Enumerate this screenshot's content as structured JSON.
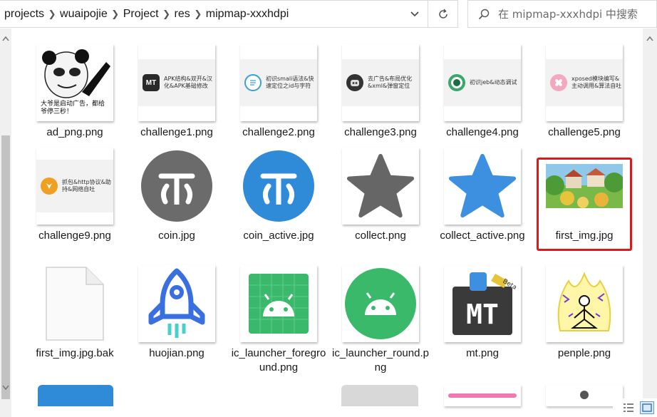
{
  "breadcrumb": [
    "projects",
    "wuaipojie",
    "Project",
    "res",
    "mipmap-xxxhdpi"
  ],
  "search": {
    "placeholder": "在 mipmap-xxxhdpi 中搜索"
  },
  "files": [
    {
      "name": "ad_png.png",
      "caption": "大爷是启动广告，都给爷停三秒！"
    },
    {
      "name": "challenge1.png",
      "caption": "APK结构&双开&汉化&APK基础修改",
      "icon_text": "MT",
      "color": "#2a2a2a"
    },
    {
      "name": "challenge2.png",
      "caption": "初识smali语法&快速定位之id与字符",
      "color": "#3aa0d8"
    },
    {
      "name": "challenge3.png",
      "caption": "去广告&布局优化&xml&弹窗定位",
      "color": "#333333"
    },
    {
      "name": "challenge4.png",
      "caption": "初识jeb&动态调试",
      "color": "#3aa86a"
    },
    {
      "name": "challenge5.png",
      "caption": "xposed模块编写&主动调用&算法自吐",
      "color": "#e86a8a"
    },
    {
      "name": "challenge9.png",
      "caption": "抓包&http协议&助持&网络自吐",
      "color": "#f0a020"
    },
    {
      "name": "coin.jpg",
      "color": "#6b6b6b"
    },
    {
      "name": "coin_active.jpg",
      "color": "#2f8ad8"
    },
    {
      "name": "collect.png",
      "color": "#666666"
    },
    {
      "name": "collect_active.png",
      "color": "#3d8fe0"
    },
    {
      "name": "first_img.jpg",
      "selected": true
    },
    {
      "name": "first_img.jpg.bak"
    },
    {
      "name": "huojian.png",
      "color": "#3a6fe0"
    },
    {
      "name": "ic_launcher_foreground.png",
      "color": "#3bb96b"
    },
    {
      "name": "ic_launcher_round.png",
      "color": "#3bb96b"
    },
    {
      "name": "mt.png",
      "icon_text": "MT",
      "badge": "Beta"
    },
    {
      "name": "penple.png"
    }
  ],
  "icons": {
    "dropdown": "chevron-down-icon",
    "refresh": "refresh-icon",
    "search": "search-icon"
  }
}
